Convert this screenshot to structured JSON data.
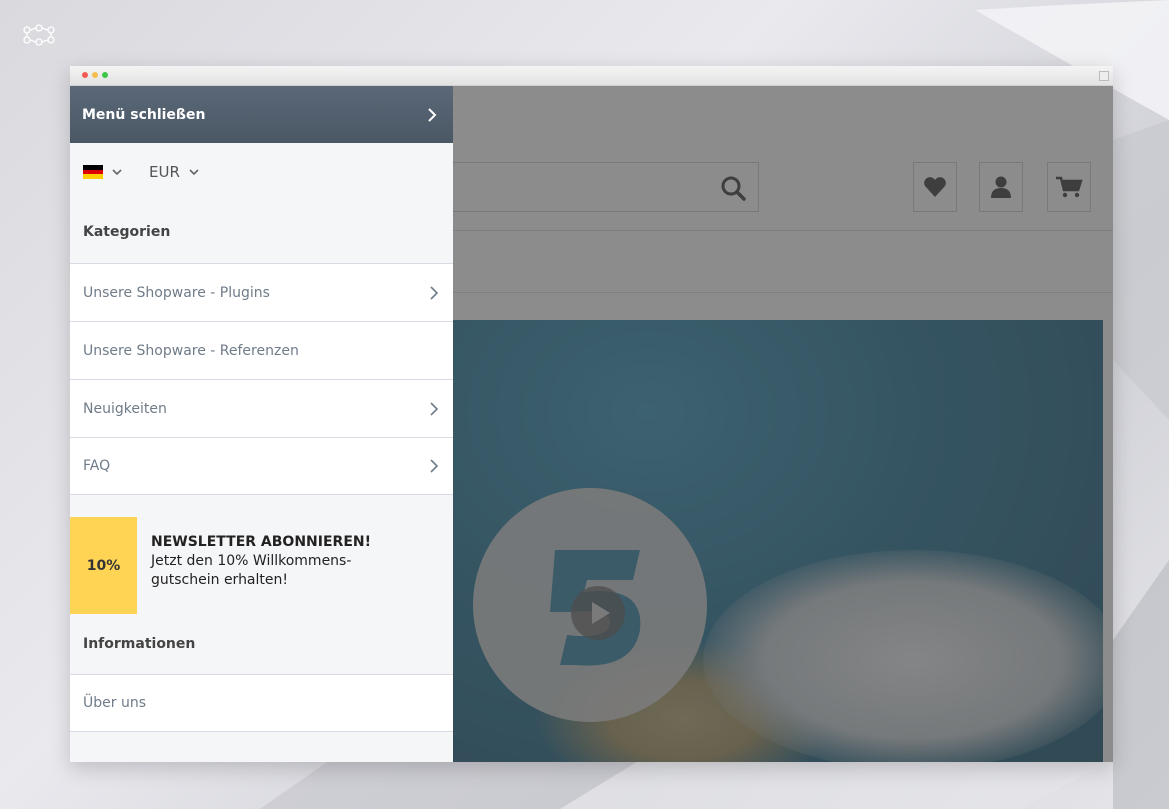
{
  "menu": {
    "close_label": "Menü schließen",
    "currency": "EUR",
    "language_flag": "flag-de-icon",
    "categories_heading": "Kategorien",
    "categories": [
      {
        "label": "Unsere Shopware - Plugins",
        "has_children": true
      },
      {
        "label": "Unsere Shopware - Referenzen",
        "has_children": false
      },
      {
        "label": "Neuigkeiten",
        "has_children": true
      },
      {
        "label": "FAQ",
        "has_children": true
      }
    ],
    "newsletter": {
      "badge": "10%",
      "title": "NEWSLETTER ABONNIEREN!",
      "line1": "Jetzt den 10% Willkommens-",
      "line2": "gutschein erhalten!"
    },
    "info_heading": "Informationen",
    "info_items": [
      {
        "label": "Über uns"
      }
    ]
  },
  "header": {
    "icons": [
      "search-icon",
      "heart-icon",
      "account-icon",
      "cart-icon"
    ]
  },
  "colors": {
    "menu_header": "#4e5c6b",
    "newsletter_badge": "#ffd455",
    "overlay": "rgba(70,70,70,0.62)"
  }
}
